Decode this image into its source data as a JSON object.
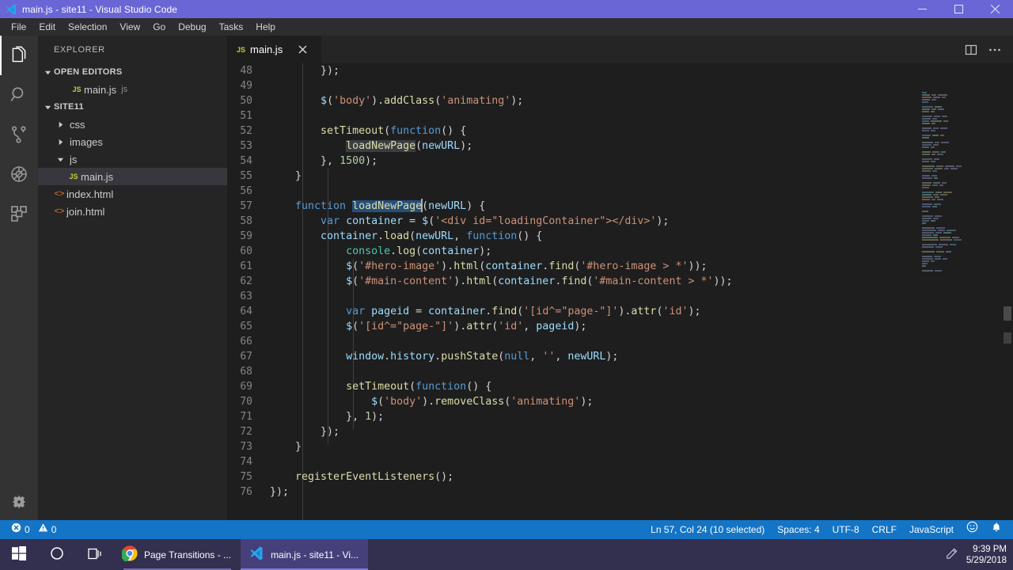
{
  "window": {
    "title": "main.js - site11 - Visual Studio Code",
    "titlebar_color": "#6a66d6",
    "controls": {
      "minimize": "minimize-icon",
      "maximize": "maximize-icon",
      "close": "close-icon"
    }
  },
  "menubar": {
    "items": [
      "File",
      "Edit",
      "Selection",
      "View",
      "Go",
      "Debug",
      "Tasks",
      "Help"
    ]
  },
  "activitybar": {
    "items": [
      {
        "name": "explorer",
        "icon": "files-icon",
        "active": true
      },
      {
        "name": "search",
        "icon": "search-icon",
        "active": false
      },
      {
        "name": "source-control",
        "icon": "source-control-icon",
        "active": false
      },
      {
        "name": "debug",
        "icon": "debug-icon",
        "active": false
      },
      {
        "name": "extensions",
        "icon": "extensions-icon",
        "active": false
      }
    ],
    "bottom": [
      {
        "name": "manage",
        "icon": "gear-icon"
      }
    ]
  },
  "sidebar": {
    "title": "EXPLORER",
    "sections": [
      {
        "label": "OPEN EDITORS",
        "expanded": true,
        "items": [
          {
            "label": "main.js",
            "sub": "js",
            "icon": "js-file-icon",
            "indent": 3,
            "selected": false
          }
        ]
      },
      {
        "label": "SITE11",
        "expanded": true,
        "items": [
          {
            "label": "css",
            "sub": "",
            "icon": "folder-icon",
            "indent": 2,
            "selected": false,
            "expanded": false
          },
          {
            "label": "images",
            "sub": "",
            "icon": "folder-icon",
            "indent": 2,
            "selected": false,
            "expanded": false
          },
          {
            "label": "js",
            "sub": "",
            "icon": "folder-icon",
            "indent": 2,
            "selected": false,
            "expanded": true
          },
          {
            "label": "main.js",
            "sub": "",
            "icon": "js-file-icon",
            "indent": 3,
            "selected": true
          },
          {
            "label": "index.html",
            "sub": "",
            "icon": "html-file-icon",
            "indent": 2,
            "selected": false
          },
          {
            "label": "join.html",
            "sub": "",
            "icon": "html-file-icon",
            "indent": 2,
            "selected": false
          }
        ]
      }
    ]
  },
  "editor": {
    "tabs": [
      {
        "label": "main.js",
        "icon": "js-file-icon",
        "active": true,
        "close": "close-icon"
      }
    ],
    "actions": [
      {
        "name": "split-editor",
        "icon": "split-editor-icon"
      },
      {
        "name": "more-actions",
        "icon": "ellipsis-icon"
      }
    ],
    "first_visible_line": 48,
    "lines": [
      {
        "n": 48,
        "text": "        });"
      },
      {
        "n": 49,
        "text": ""
      },
      {
        "n": 50,
        "text": "        $('body').addClass('animating');"
      },
      {
        "n": 51,
        "text": ""
      },
      {
        "n": 52,
        "text": "        setTimeout(function() {"
      },
      {
        "n": 53,
        "text": "            loadNewPage(newURL);"
      },
      {
        "n": 54,
        "text": "        }, 1500);"
      },
      {
        "n": 55,
        "text": "    }"
      },
      {
        "n": 56,
        "text": ""
      },
      {
        "n": 57,
        "text": "    function loadNewPage(newURL) {"
      },
      {
        "n": 58,
        "text": "        var container = $('<div id=\"loadingContainer\"></div>');"
      },
      {
        "n": 59,
        "text": "        container.load(newURL, function() {"
      },
      {
        "n": 60,
        "text": "            console.log(container);"
      },
      {
        "n": 61,
        "text": "            $('#hero-image').html(container.find('#hero-image > *'));"
      },
      {
        "n": 62,
        "text": "            $('#main-content').html(container.find('#main-content > *'));"
      },
      {
        "n": 63,
        "text": ""
      },
      {
        "n": 64,
        "text": "            var pageid = container.find('[id^=\"page-\"]').attr('id');"
      },
      {
        "n": 65,
        "text": "            $('[id^=\"page-\"]').attr('id', pageid);"
      },
      {
        "n": 66,
        "text": ""
      },
      {
        "n": 67,
        "text": "            window.history.pushState(null, '', newURL);"
      },
      {
        "n": 68,
        "text": ""
      },
      {
        "n": 69,
        "text": "            setTimeout(function() {"
      },
      {
        "n": 70,
        "text": "                $('body').removeClass('animating');"
      },
      {
        "n": 71,
        "text": "            }, 1);"
      },
      {
        "n": 72,
        "text": "        });"
      },
      {
        "n": 73,
        "text": "    }"
      },
      {
        "n": 74,
        "text": ""
      },
      {
        "n": 75,
        "text": "    registerEventListeners();"
      },
      {
        "n": 76,
        "text": "});"
      }
    ],
    "selection_text": "loadNewPage",
    "occurrence_text": "loadNewPage"
  },
  "statusbar": {
    "background": "#1474c6",
    "errors": {
      "icon": "error-icon",
      "count": "0"
    },
    "warnings": {
      "icon": "warning-icon",
      "count": "0"
    },
    "position": "Ln 57, Col 24 (10 selected)",
    "indentation": "Spaces: 4",
    "encoding": "UTF-8",
    "eol": "CRLF",
    "language": "JavaScript",
    "feedback_icon": "smiley-icon",
    "notifications_icon": "bell-icon"
  },
  "taskbar": {
    "background": "#332f4e",
    "start": "windows-start-icon",
    "cortana": "cortana-circle-icon",
    "taskview": "task-view-icon",
    "apps": [
      {
        "label": "Page Transitions - ...",
        "icon": "chrome-icon",
        "state": "running"
      },
      {
        "label": "main.js - site11 - Vi...",
        "icon": "vscode-icon",
        "state": "open"
      }
    ],
    "tray_icon": "pen-icon",
    "time": "9:39 PM",
    "date": "5/29/2018"
  }
}
